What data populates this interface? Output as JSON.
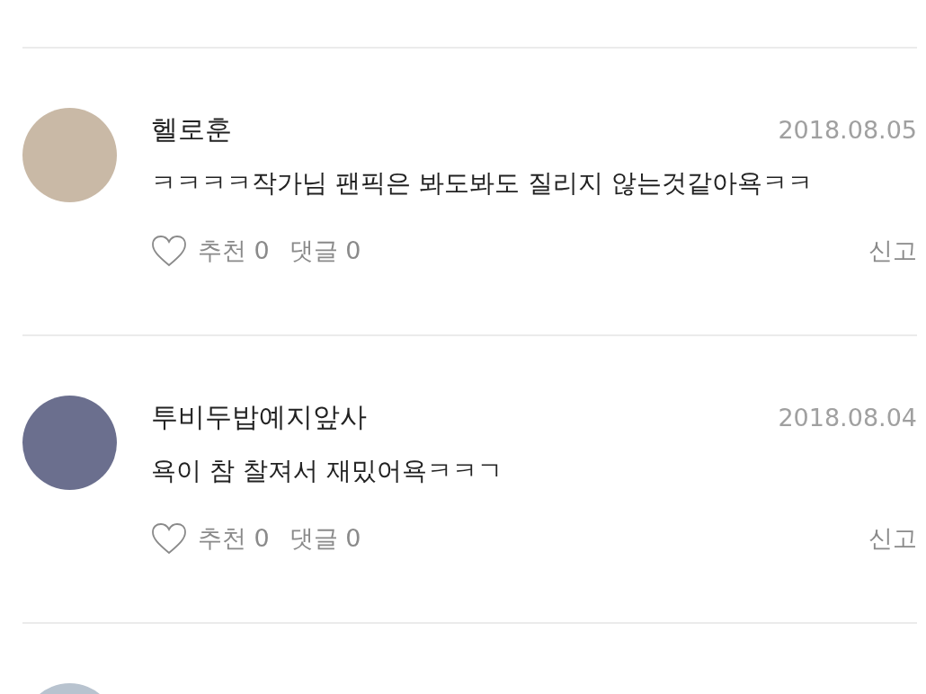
{
  "comments": [
    {
      "author": "헬로훈",
      "date": "2018.08.05",
      "text": "ㅋㅋㅋㅋ작가님 팬픽은 봐도봐도 질리지 않는것같아욕ㅋㅋ",
      "liked": false,
      "likes_label": "추천 0",
      "replies_label": "댓글 0",
      "report_label": "신고"
    },
    {
      "author": "투비두밥예지앞사",
      "date": "2018.08.04",
      "text": "욕이 참 찰져서 재밌어욕ㅋㅋㄱ",
      "liked": false,
      "likes_label": "추천 0",
      "replies_label": "댓글 0",
      "report_label": "신고"
    }
  ]
}
